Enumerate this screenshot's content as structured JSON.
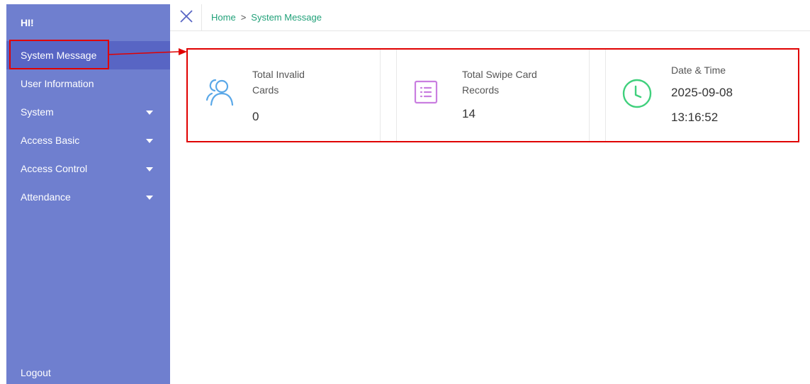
{
  "sidebar": {
    "greeting": "HI!",
    "items": [
      {
        "label": "System Message"
      },
      {
        "label": "User Information"
      },
      {
        "label": "System"
      },
      {
        "label": "Access Basic"
      },
      {
        "label": "Access Control"
      },
      {
        "label": "Attendance"
      }
    ],
    "logout": "Logout",
    "colors": {
      "background": "#6f7fcf",
      "active": "#5865c4"
    }
  },
  "topbar": {
    "close_icon": "close-icon",
    "breadcrumb": {
      "home": "Home",
      "separator": ">",
      "current": "System Message"
    }
  },
  "cards": [
    {
      "label_line1": "Total Invalid",
      "label_line2": "Cards",
      "value": "0",
      "icon": "user-group-icon",
      "icon_color": "#5aa8e8"
    },
    {
      "label_line1": "Total Swipe Card",
      "label_line2": "Records",
      "value": "14",
      "icon": "list-icon",
      "icon_color": "#c97ee0"
    },
    {
      "label": "Date & Time",
      "date": "2025-09-08",
      "time": "13:16:52",
      "icon": "clock-icon",
      "icon_color": "#3fd07c"
    }
  ],
  "annotation_color": "#e00000"
}
